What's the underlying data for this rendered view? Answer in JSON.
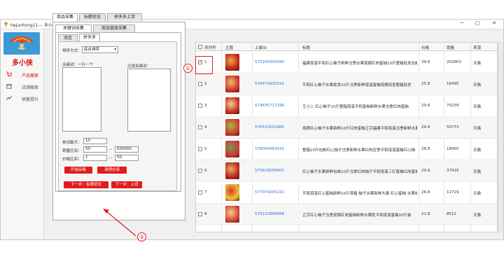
{
  "window": {
    "title": "hejunhong11--- 多小侠搬家助手 v1.1.0.0",
    "minimize": "─",
    "maximize": "□",
    "close": "✕"
  },
  "sidebar": {
    "brand": "多小侠",
    "items": [
      {
        "label": "产品搬家",
        "icon": "cart-icon",
        "active": true
      },
      {
        "label": "店铺搬家",
        "icon": "store-icon",
        "active": false
      },
      {
        "label": "销量提升",
        "icon": "trend-icon",
        "active": false
      }
    ]
  },
  "main_tabs": [
    "商品采集",
    "标题优化",
    "拼多多上货"
  ],
  "sub_tabs": [
    "关键词采集",
    "商品链接采集"
  ],
  "source_tabs": [
    "淘宝",
    "拼多多"
  ],
  "form": {
    "sort_label": "排序方式：",
    "sort_value": "综合排序",
    "keywords_label": "关键词：一行一个",
    "filter_label": "过滤关键词：",
    "max_per_page_label": "单词最大：",
    "max_per_page_value": "10",
    "sales_range_label": "销量区间：",
    "sales_min": "50",
    "sales_max": "500000",
    "price_range_label": "价格区间：",
    "price_min": "1",
    "price_max": "50",
    "range_sep": "--",
    "start_button": "开始采集",
    "clear_button": "清理全部",
    "next_title_button": "下一步：标题优化",
    "next_upload_button": "下一步：上货"
  },
  "table": {
    "headers": [
      "序列号",
      "主图",
      "上家ID",
      "标题",
      "价格",
      "销量",
      "来源"
    ],
    "rows": [
      {
        "no": "1",
        "id": "575100303090",
        "title": "福建琯溪平和红心柚子新鲜当季水果现摘红肉蜜柚10斤整箱批发包邮",
        "price": "39.8",
        "sales": "202903",
        "source": "天猫",
        "checked": true
      },
      {
        "no": "2",
        "id": "578470930191",
        "title": "平和红心柚子水果批发10斤当季新鲜琯溪蜜柚现摘现发整箱批发",
        "price": "25.8",
        "sales": "16495",
        "source": "天猫",
        "checked": false
      },
      {
        "no": "3",
        "id": "574635717296",
        "title": "王小二 红心柚子10斤整箱琯溪平和蜜柚新鲜水果当季红肉蜜柚",
        "price": "29.8",
        "sales": "70239",
        "source": "天猫",
        "checked": false
      },
      {
        "no": "4",
        "id": "576533501985",
        "title": "现摘红心柚子水果新鲜10斤红肉蜜柚正宗福建平和琯溪当季新鲜水果",
        "price": "29.9",
        "sales": "50773",
        "source": "天猫",
        "checked": false
      },
      {
        "no": "5",
        "id": "576054983432",
        "title": "整箱10斤包邮红心柚子当季新鲜水果红肉应季平和琯溪蜜柚红心柚",
        "price": "28.8",
        "sales": "18450",
        "source": "天猫",
        "checked": false
      },
      {
        "no": "6",
        "id": "575619059901",
        "title": "红心柚子水果新鲜包邮10斤当季红肉柚子平和琯溪三红蜜柚红肉蜜柚",
        "price": "29.9",
        "sales": "37916",
        "source": "天猫",
        "checked": false
      },
      {
        "no": "7",
        "id": "577074205231",
        "title": "平和琯溪红心蜜柚新鲜10斤带箱 柚子水果新鲜大果 红心蜜柚 水果柚子",
        "price": "26.8",
        "sales": "11729",
        "source": "天猫",
        "checked": false
      },
      {
        "no": "8",
        "id": "579131856968",
        "title": "正宗红心柚子当季现摘红肉蜜柚新鲜水果胜平和琯溪蜜柚10斤装",
        "price": "21.8",
        "sales": "8512",
        "source": "天猫",
        "checked": false
      }
    ]
  },
  "annotations": [
    "①",
    "②"
  ],
  "colors": {
    "accent": "#e21b1b",
    "link": "#2a6fdb"
  }
}
